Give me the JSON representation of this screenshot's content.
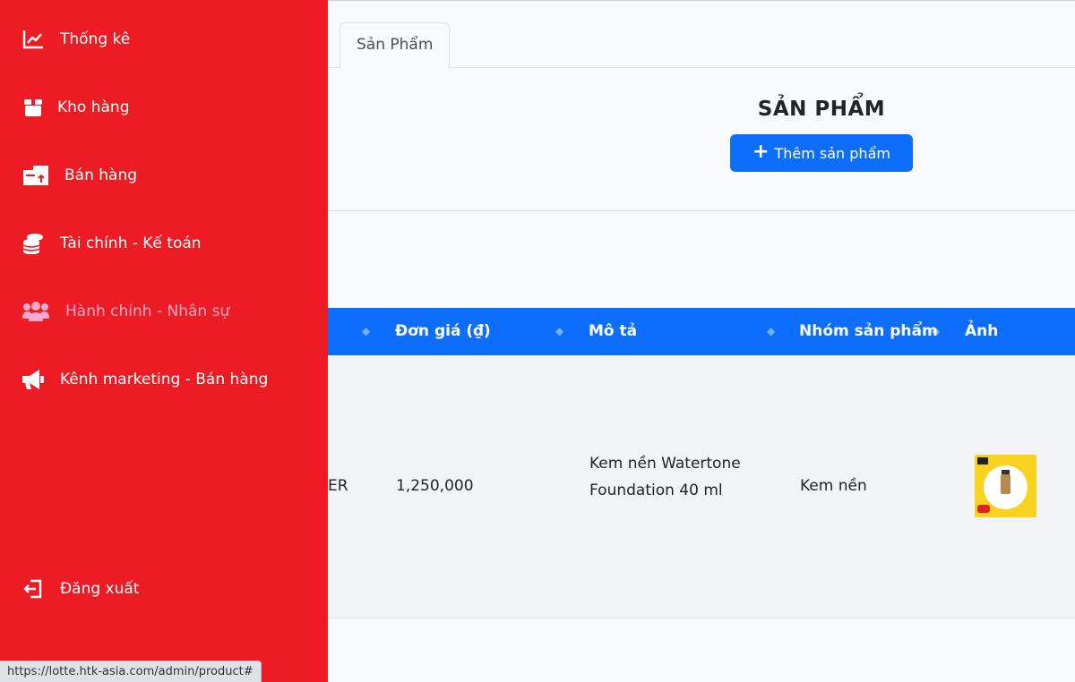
{
  "sidebar": {
    "items": [
      {
        "label": "Thống kê",
        "icon": "chart-line-icon"
      },
      {
        "label": "Kho hàng",
        "icon": "box-icon"
      },
      {
        "label": "Bán hàng",
        "icon": "store-icon"
      },
      {
        "label": "Tài chính - Kế toán",
        "icon": "coins-icon"
      },
      {
        "label": "Hành chính - Nhân sự",
        "icon": "users-icon"
      },
      {
        "label": "Kênh marketing - Bán hàng",
        "icon": "megaphone-icon"
      }
    ],
    "logout_label": "Đăng xuất"
  },
  "tabs": [
    {
      "label": "Sản Phẩm"
    }
  ],
  "page": {
    "title": "SẢN PHẨM",
    "add_button_label": "Thêm sản phẩm"
  },
  "table": {
    "columns": [
      "Đơn giá (₫)",
      "Mô tả",
      "Nhóm sản phẩm",
      "Ảnh"
    ],
    "rows": [
      {
        "code_partial": "ER",
        "price": "1,250,000",
        "description_line1": "Kem nền Watertone",
        "description_line2": "Foundation 40 ml",
        "group": "Kem nền"
      }
    ]
  },
  "status_bar": {
    "url": "https://lotte.htk-asia.com/admin/product#"
  },
  "colors": {
    "sidebar": "#ed1c24",
    "primary": "#0d6efd",
    "muted_nav": "#f4a9c9"
  }
}
